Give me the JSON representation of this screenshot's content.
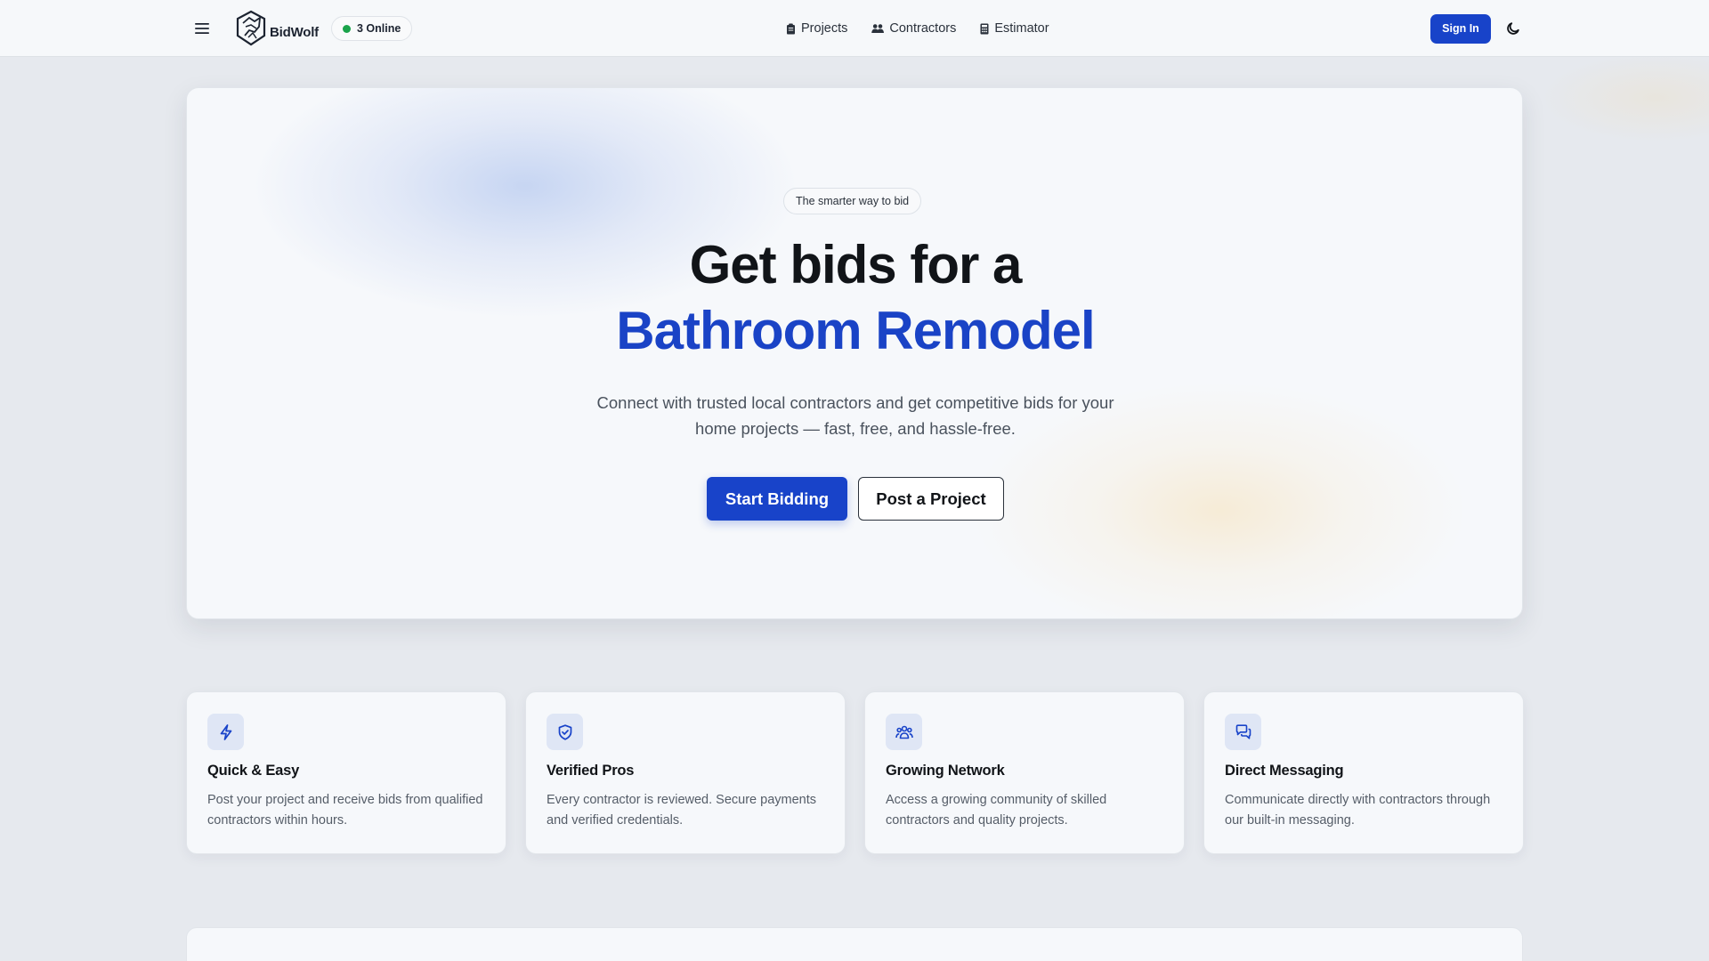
{
  "nav": {
    "brand": "BidWolf",
    "online": "3 Online",
    "links": [
      {
        "label": "Projects",
        "icon": "clipboard-icon"
      },
      {
        "label": "Contractors",
        "icon": "users-icon"
      },
      {
        "label": "Estimator",
        "icon": "calculator-icon"
      }
    ],
    "sign_in": "Sign In",
    "theme_icon": "moon-icon",
    "status_color": "#1aa34a"
  },
  "hero": {
    "tagline": "The smarter way to bid",
    "title_line1": "Get bids for a",
    "title_line2": "Bathroom Remodel",
    "subtitle": "Connect with trusted local contractors and get competitive bids for your home projects — fast, free, and hassle-free.",
    "primary_cta": "Start Bidding",
    "secondary_cta": "Post a Project",
    "accent_color": "#1a43c6"
  },
  "features": [
    {
      "title": "Quick & Easy",
      "description": "Post your project and receive bids from qualified contractors within hours.",
      "icon": "lightning-icon"
    },
    {
      "title": "Verified Pros",
      "description": "Every contractor is reviewed. Secure payments and verified credentials.",
      "icon": "shield-check-icon"
    },
    {
      "title": "Growing Network",
      "description": "Access a growing community of skilled contractors and quality projects.",
      "icon": "group-icon"
    },
    {
      "title": "Direct Messaging",
      "description": "Communicate directly with contractors through our built-in messaging.",
      "icon": "chat-icon"
    }
  ]
}
